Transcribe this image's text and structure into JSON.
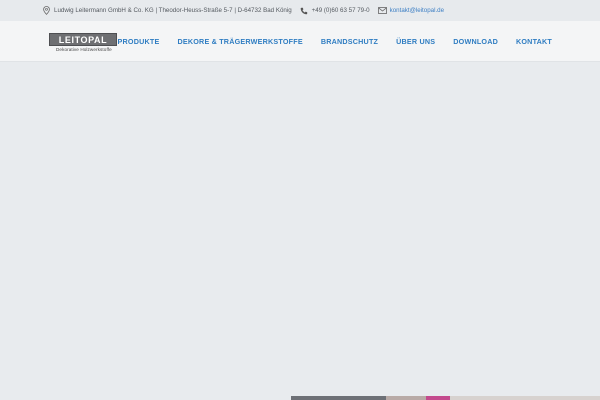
{
  "topbar": {
    "address": "Ludwig Leitermann GmbH & Co. KG | Theodor-Heuss-Straße 5-7 | D-64732 Bad König",
    "phone": "+49 (0)60 63 57 79-0",
    "email": "kontakt@leitopal.de",
    "icons": [
      "location-pin-icon",
      "phone-icon",
      "mail-icon"
    ]
  },
  "logo": {
    "name": "LEITOPAL",
    "tagline": "Dekorative Holzwerkstoffe"
  },
  "nav": {
    "items": [
      {
        "label": "PRODUKTE"
      },
      {
        "label": "DEKORE & TRÄGERWERKSTOFFE"
      },
      {
        "label": "BRANDSCHUTZ"
      },
      {
        "label": "ÜBER UNS"
      },
      {
        "label": "DOWNLOAD"
      },
      {
        "label": "KONTAKT"
      }
    ]
  },
  "colors": {
    "accent": "#2f7dc2",
    "topbar_bg": "#e7eaed",
    "header_bg": "#f4f5f6",
    "hero_bg": "#e8ebee",
    "logo_bg": "#6e6f72"
  }
}
